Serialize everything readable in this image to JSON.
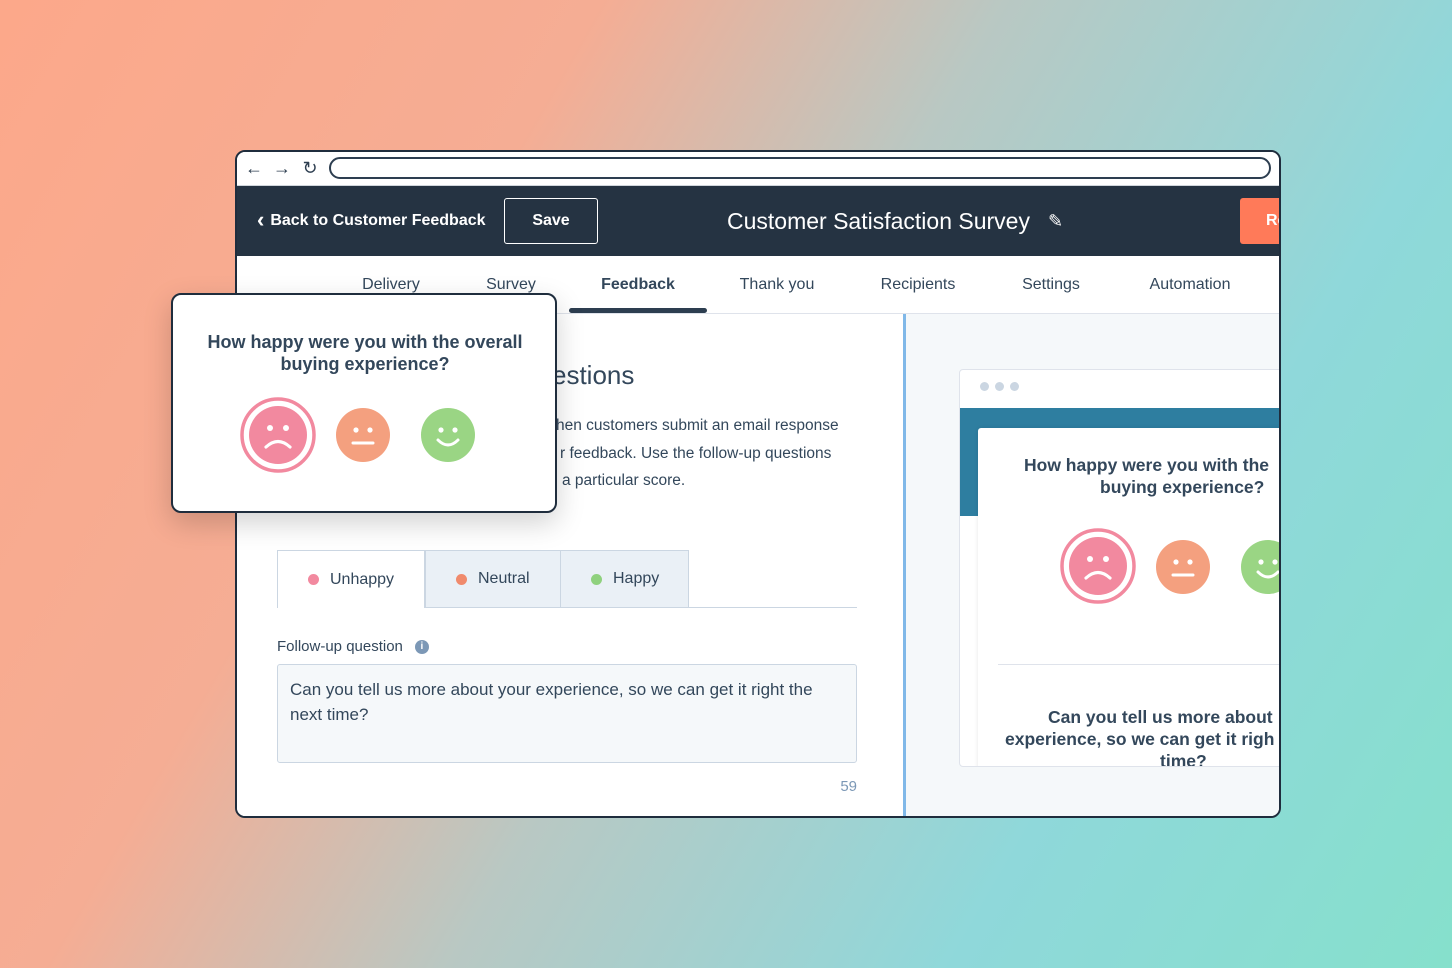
{
  "browser": {
    "back_icon": "arrow-left-icon",
    "forward_icon": "arrow-right-icon",
    "refresh_icon": "refresh-icon",
    "url": ""
  },
  "header": {
    "back_label": "Back to Customer Feedback",
    "save_label": "Save",
    "title": "Customer Satisfaction Survey",
    "edit_icon": "pencil-icon",
    "review_label": "Re"
  },
  "tabs": [
    {
      "label": "Delivery",
      "active": false
    },
    {
      "label": "Survey",
      "active": false
    },
    {
      "label": "Feedback",
      "active": true
    },
    {
      "label": "Thank you",
      "active": false
    },
    {
      "label": "Recipients",
      "active": false
    },
    {
      "label": "Settings",
      "active": false
    },
    {
      "label": "Automation",
      "active": false
    }
  ],
  "section": {
    "heading": "estions",
    "description_lines": [
      "hen customers submit an email response",
      "r feedback. Use the follow-up questions",
      "a particular score."
    ]
  },
  "score_tabs": [
    {
      "label": "Unhappy",
      "color": "#f2899f",
      "active": true
    },
    {
      "label": "Neutral",
      "color": "#f08a6c",
      "active": false
    },
    {
      "label": "Happy",
      "color": "#8fd17e",
      "active": false
    }
  ],
  "followup": {
    "label": "Follow-up question",
    "info_icon": "info-icon",
    "value": "Can you tell us more about your experience, so we can get it right the next time?",
    "char_count": "59"
  },
  "preview": {
    "question_lines": [
      "How happy were you with the",
      "buying experience?"
    ],
    "followup_lines": [
      "Can you tell us more about",
      "experience, so we can get it righ",
      "time?"
    ]
  },
  "popup": {
    "question": "How happy were you with the overall buying experience?"
  },
  "faces": [
    {
      "name": "sad",
      "color": "#f2899f",
      "selected": true
    },
    {
      "name": "neutral",
      "color": "#f4a07f",
      "selected": false
    },
    {
      "name": "happy",
      "color": "#9ad584",
      "selected": false
    }
  ],
  "colors": {
    "header_bg": "#253342",
    "accent_orange": "#ff7a59",
    "text_dark": "#33475b",
    "divider_blue": "#80b8e8"
  }
}
